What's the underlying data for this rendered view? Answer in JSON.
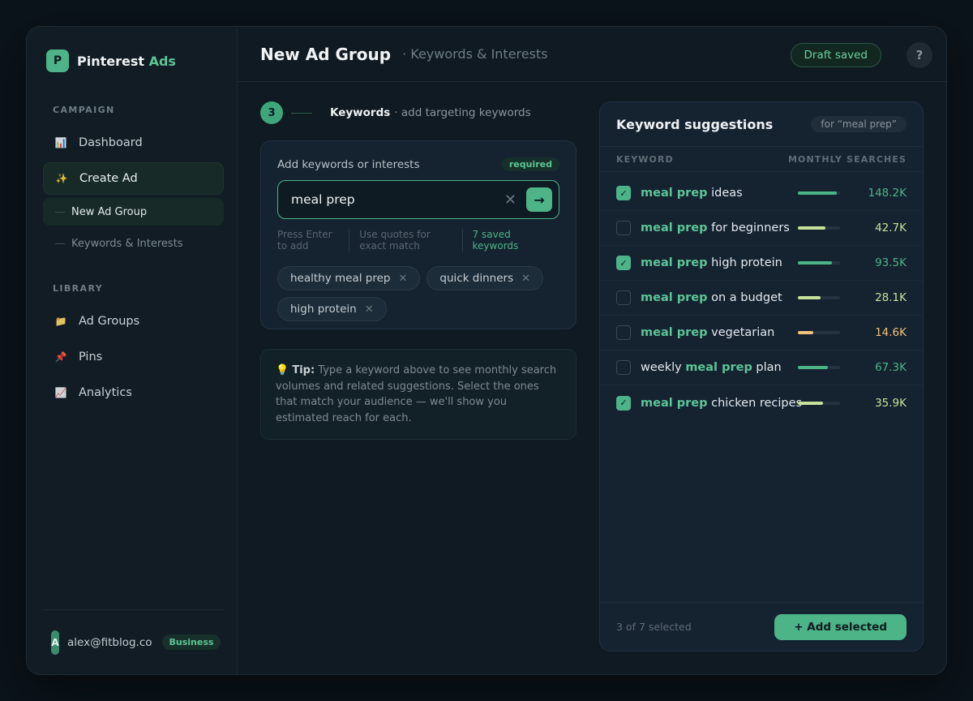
{
  "brand": {
    "logo_letter": "P",
    "name": "Pinterest",
    "accent": "Ads",
    "accent_color": "#5cc596"
  },
  "sidebar": {
    "campaign_label": "CAMPAIGN",
    "campaign_items": [
      {
        "label": "Dashboard",
        "icon": "bar-chart-icon",
        "glyph": "📊"
      },
      {
        "label": "Create Ad",
        "icon": "sparkles-icon",
        "glyph": "✨"
      }
    ],
    "sub_items": [
      {
        "label": "New Ad Group"
      },
      {
        "label": "Keywords & Interests"
      }
    ],
    "library_label": "LIBRARY",
    "library_items": [
      {
        "label": "Ad Groups",
        "icon": "folder-icon",
        "glyph": "📁"
      },
      {
        "label": "Pins",
        "icon": "pushpin-icon",
        "glyph": "📌"
      },
      {
        "label": "Analytics",
        "icon": "trend-chart-icon",
        "glyph": "📈"
      }
    ],
    "user": {
      "avatar_letter": "A",
      "email": "alex@fitblog.co",
      "plan": "Business"
    }
  },
  "header": {
    "title": "New Ad Group",
    "subtitle": "· Keywords & Interests",
    "draft_status": "Draft saved",
    "help_label": "?"
  },
  "step": {
    "number": "3",
    "title": "Keywords",
    "description": "· add targeting keywords"
  },
  "keyword_card": {
    "label": "Add keywords or interests",
    "required_badge": "required",
    "input_value": "meal prep",
    "clear_glyph": "✕",
    "submit_glyph": "→",
    "hints": [
      "Press Enter to add",
      "Use quotes for exact match",
      "7 saved keywords"
    ],
    "chips": [
      {
        "label": "healthy meal prep"
      },
      {
        "label": "quick dinners"
      },
      {
        "label": "high protein"
      }
    ],
    "chip_remove_glyph": "✕"
  },
  "tip": {
    "icon": "lightbulb-icon",
    "glyph": "💡",
    "lead": "Tip:",
    "text": "Type a keyword above to see monthly search volumes and related suggestions. Select the ones that match your audience — we'll show you estimated reach for each."
  },
  "suggestions": {
    "title": "Keyword suggestions",
    "for_label": "for “meal prep”",
    "col_keyword": "KEYWORD",
    "col_searches": "MONTHLY SEARCHES",
    "rows": [
      {
        "prefix": "",
        "highlight": "meal prep",
        "suffix": " ideas",
        "checked": true,
        "volume": "148.2K",
        "level": 0.92,
        "color": "#4cb487"
      },
      {
        "prefix": "",
        "highlight": "meal prep",
        "suffix": " for beginners",
        "checked": false,
        "volume": "42.7K",
        "level": 0.66,
        "color": "#c6e29a"
      },
      {
        "prefix": "",
        "highlight": "meal prep",
        "suffix": " high protein",
        "checked": true,
        "volume": "93.5K",
        "level": 0.8,
        "color": "#4cb487"
      },
      {
        "prefix": "",
        "highlight": "meal prep",
        "suffix": " on a budget",
        "checked": false,
        "volume": "28.1K",
        "level": 0.54,
        "color": "#c6e29a"
      },
      {
        "prefix": "",
        "highlight": "meal prep",
        "suffix": " vegetarian",
        "checked": false,
        "volume": "14.6K",
        "level": 0.36,
        "color": "#f2c27a"
      },
      {
        "prefix": "weekly ",
        "highlight": "meal prep",
        "suffix": " plan",
        "checked": false,
        "volume": "67.3K",
        "level": 0.72,
        "color": "#4cb487"
      },
      {
        "prefix": "",
        "highlight": "meal prep",
        "suffix": " chicken recipes",
        "checked": true,
        "volume": "35.9K",
        "level": 0.6,
        "color": "#c6e29a"
      }
    ],
    "selected_count": "3 of 7 selected",
    "add_button": "+ Add selected",
    "check_glyph": "✓"
  }
}
